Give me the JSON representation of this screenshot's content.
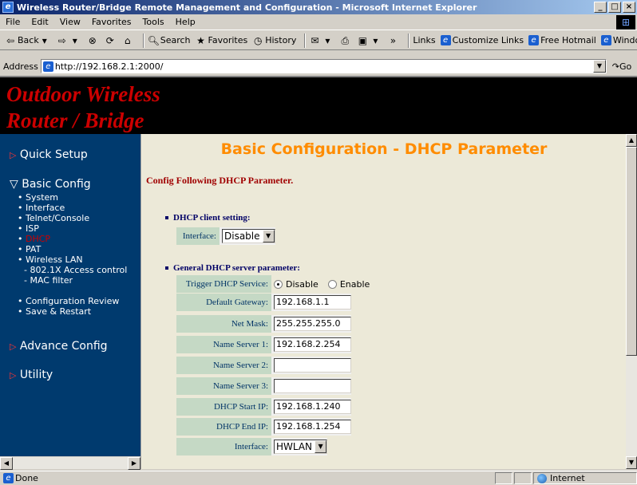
{
  "window": {
    "title": "Wireless Router/Bridge Remote Management and Configuration - Microsoft Internet Explorer",
    "icon": "ie-logo-icon"
  },
  "menubar": [
    "File",
    "Edit",
    "View",
    "Favorites",
    "Tools",
    "Help"
  ],
  "toolbar": {
    "back": "Back",
    "search": "Search",
    "favorites": "Favorites",
    "history": "History",
    "links_label": "Links",
    "links": [
      "Customize Links",
      "Free Hotmail",
      "Windows"
    ]
  },
  "address": {
    "label": "Address",
    "url": "http://192.168.2.1:2000/",
    "go": "Go"
  },
  "banner": {
    "line1": "Outdoor Wireless",
    "line2": "Router / Bridge"
  },
  "sidebar": {
    "quick_setup": "Quick Setup",
    "basic_config": "Basic Config",
    "basic_items": [
      "System",
      "Interface",
      "Telnet/Console",
      "ISP",
      "DHCP",
      "PAT",
      "Wireless LAN"
    ],
    "wireless_sub": [
      "- 802.1X Access control",
      "- MAC filter"
    ],
    "review_items": [
      "Configuration Review",
      "Save & Restart"
    ],
    "advance_config": "Advance Config",
    "utility": "Utility"
  },
  "main": {
    "heading": "Basic Configuration - DHCP Parameter",
    "intro": "Config Following DHCP Parameter.",
    "client_section": "DHCP client setting:",
    "client_interface_label": "Interface:",
    "client_interface_value": "Disable",
    "server_section": "General DHCP server parameter:",
    "trigger_label": "Trigger DHCP Service:",
    "trigger_options": [
      "Disable",
      "Enable"
    ],
    "trigger_selected": "Disable",
    "fields": [
      {
        "label": "Default Gateway:",
        "value": "192.168.1.1"
      },
      {
        "label": "Net Mask:",
        "value": "255.255.255.0"
      },
      {
        "label": "Name Server 1:",
        "value": "192.168.2.254"
      },
      {
        "label": "Name Server 2:",
        "value": ""
      },
      {
        "label": "Name Server 3:",
        "value": ""
      },
      {
        "label": "DHCP Start IP:",
        "value": "192.168.1.240"
      },
      {
        "label": "DHCP End IP:",
        "value": "192.168.1.254"
      }
    ],
    "server_interface_label": "Interface:",
    "server_interface_value": "HWLAN"
  },
  "status": {
    "text": "Done",
    "zone": "Internet"
  }
}
